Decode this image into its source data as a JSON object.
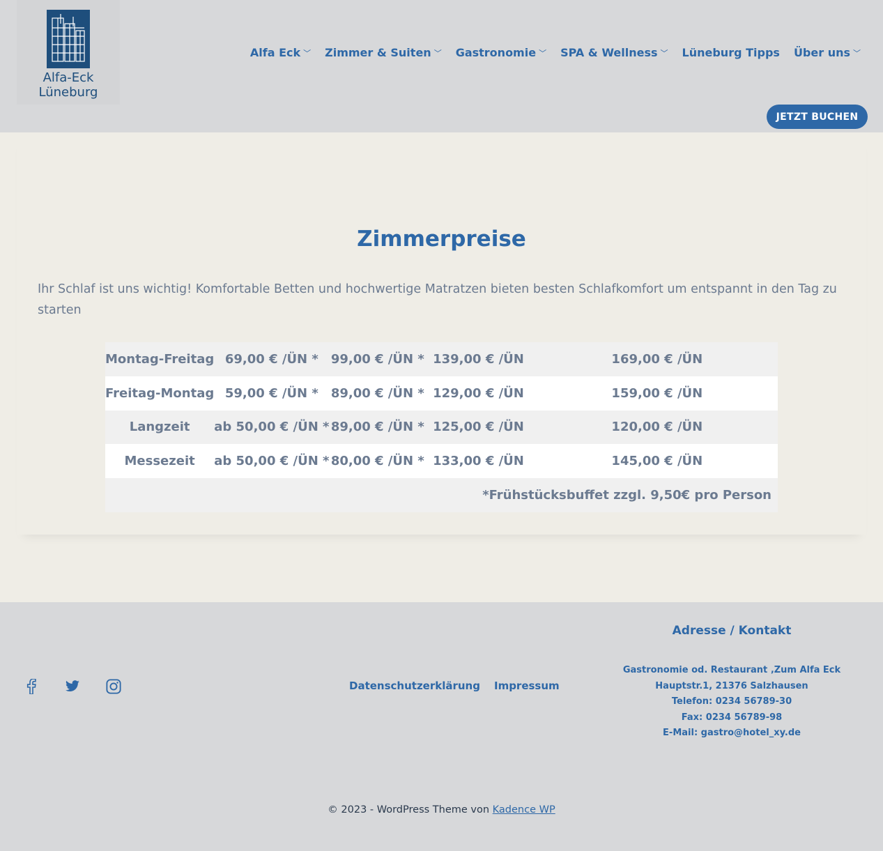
{
  "header": {
    "logo": {
      "line1": "Alfa-Eck",
      "line2": "Lüneburg"
    },
    "nav": [
      {
        "label": "Alfa Eck",
        "dropdown": true
      },
      {
        "label": "Zimmer & Suiten",
        "dropdown": true
      },
      {
        "label": "Gastronomie",
        "dropdown": true
      },
      {
        "label": "SPA & Wellness",
        "dropdown": true
      },
      {
        "label": "Lüneburg Tipps",
        "dropdown": false
      },
      {
        "label": "Über uns",
        "dropdown": true
      }
    ],
    "book_button": "JETZT BUCHEN"
  },
  "main": {
    "title": "Zimmerpreise",
    "intro": "Ihr Schlaf ist uns wichtig! Komfortable Betten und hochwertige Matratzen bieten besten Schlafkomfort um entspannt in den Tag zu starten",
    "price_table": {
      "rows": [
        [
          "Montag-Freitag",
          "69,00 € /ÜN *",
          "99,00 € /ÜN *",
          "139,00 € /ÜN",
          "169,00 € /ÜN"
        ],
        [
          "Freitag-Montag",
          "59,00 € /ÜN *",
          "89,00 € /ÜN *",
          "129,00 € /ÜN",
          "159,00 € /ÜN"
        ],
        [
          "Langzeit",
          "ab 50,00 € /ÜN *",
          "89,00 € /ÜN *",
          "125,00 € /ÜN",
          "120,00 € /ÜN"
        ],
        [
          "Messezeit",
          "ab 50,00 € /ÜN *",
          "80,00 € /ÜN *",
          "133,00 € /ÜN",
          "145,00 € /ÜN"
        ]
      ],
      "footnote": "*Frühstücksbuffet zzgl. 9,50€ pro Person"
    }
  },
  "footer": {
    "social": [
      "facebook-icon",
      "twitter-icon",
      "instagram-icon"
    ],
    "legal_links": [
      "Datenschutzerklärung",
      "Impressum"
    ],
    "contact": {
      "title": "Adresse / Kontakt",
      "lines": [
        "Gastronomie od. Restaurant ‚Zum Alfa Eck",
        "Hauptstr.1, 21376 Salzhausen",
        "Telefon: 0234 56789-30",
        "Fax: 0234 56789-98",
        "E-Mail: gastro@hotel_xy.de"
      ]
    },
    "copyright_text": "© 2023 - WordPress Theme von ",
    "copyright_link": "Kadence WP"
  },
  "colors": {
    "accent": "#2e68a7",
    "header_bg": "#d7d8da",
    "page_bg": "#efede6",
    "text": "#6b7a90",
    "logo_blue": "#1e4e7c"
  }
}
